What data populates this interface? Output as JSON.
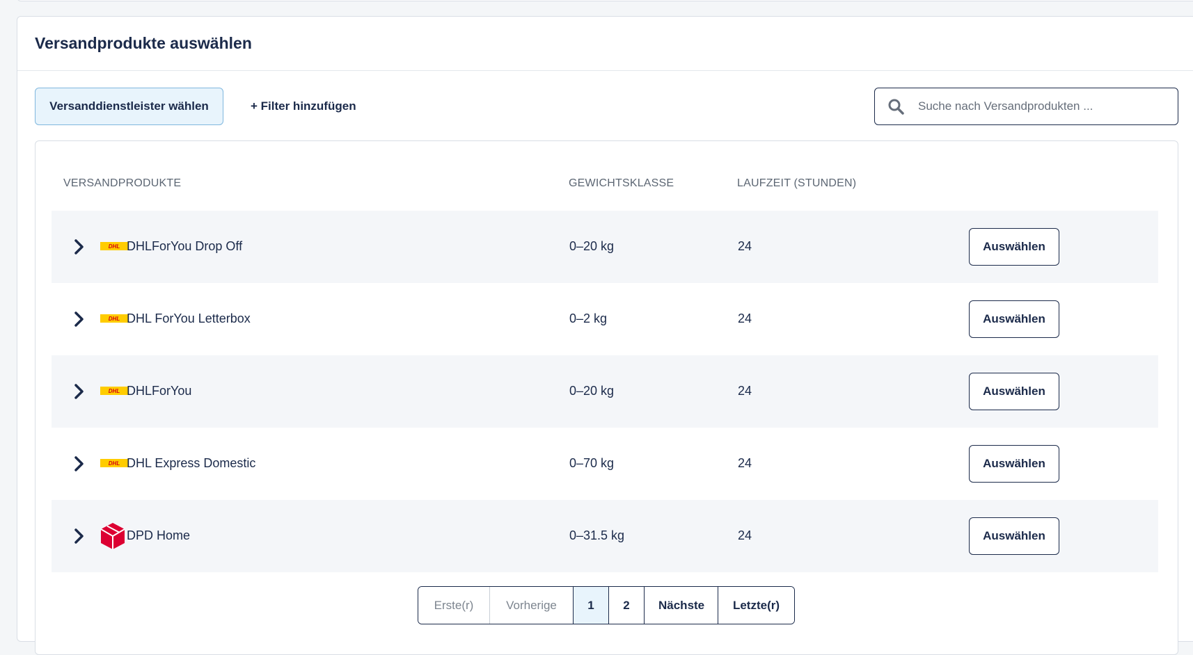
{
  "panel": {
    "title": "Versandprodukte auswählen"
  },
  "toolbar": {
    "provider_button": "Versanddienstleister wählen",
    "filter_button": "+ Filter hinzufügen",
    "search_placeholder": "Suche nach Versandprodukten ..."
  },
  "table": {
    "headers": {
      "product": "VERSANDPRODUKTE",
      "weight": "GEWICHTSKLASSE",
      "time": "LAUFZEIT (STUNDEN)"
    },
    "rows": [
      {
        "carrier": "DHL",
        "name": "DHLForYou Drop Off",
        "weight": "0–20 kg",
        "time": "24",
        "action": "Auswählen"
      },
      {
        "carrier": "DHL",
        "name": "DHL ForYou Letterbox",
        "weight": "0–2 kg",
        "time": "24",
        "action": "Auswählen"
      },
      {
        "carrier": "DHL",
        "name": "DHLForYou",
        "weight": "0–20 kg",
        "time": "24",
        "action": "Auswählen"
      },
      {
        "carrier": "DHL",
        "name": "DHL Express Domestic",
        "weight": "0–70 kg",
        "time": "24",
        "action": "Auswählen"
      },
      {
        "carrier": "DPD",
        "name": "DPD Home",
        "weight": "0–31.5 kg",
        "time": "24",
        "action": "Auswählen"
      }
    ]
  },
  "pagination": {
    "first": "Erste(r)",
    "previous": "Vorherige",
    "pages": [
      "1",
      "2"
    ],
    "current": "1",
    "next": "Nächste",
    "last": "Letzte(r)"
  },
  "colors": {
    "primary": "#1b2a4a",
    "accent_bg": "#e8f4fc",
    "accent_border": "#7fb7de",
    "dhl_yellow": "#ffcc00",
    "dhl_red": "#d40511",
    "dpd_red": "#dc0032"
  },
  "icons": {
    "search": "search-icon",
    "expand": "chevron-right-icon",
    "dhl": "dhl-logo",
    "dpd": "dpd-logo"
  }
}
